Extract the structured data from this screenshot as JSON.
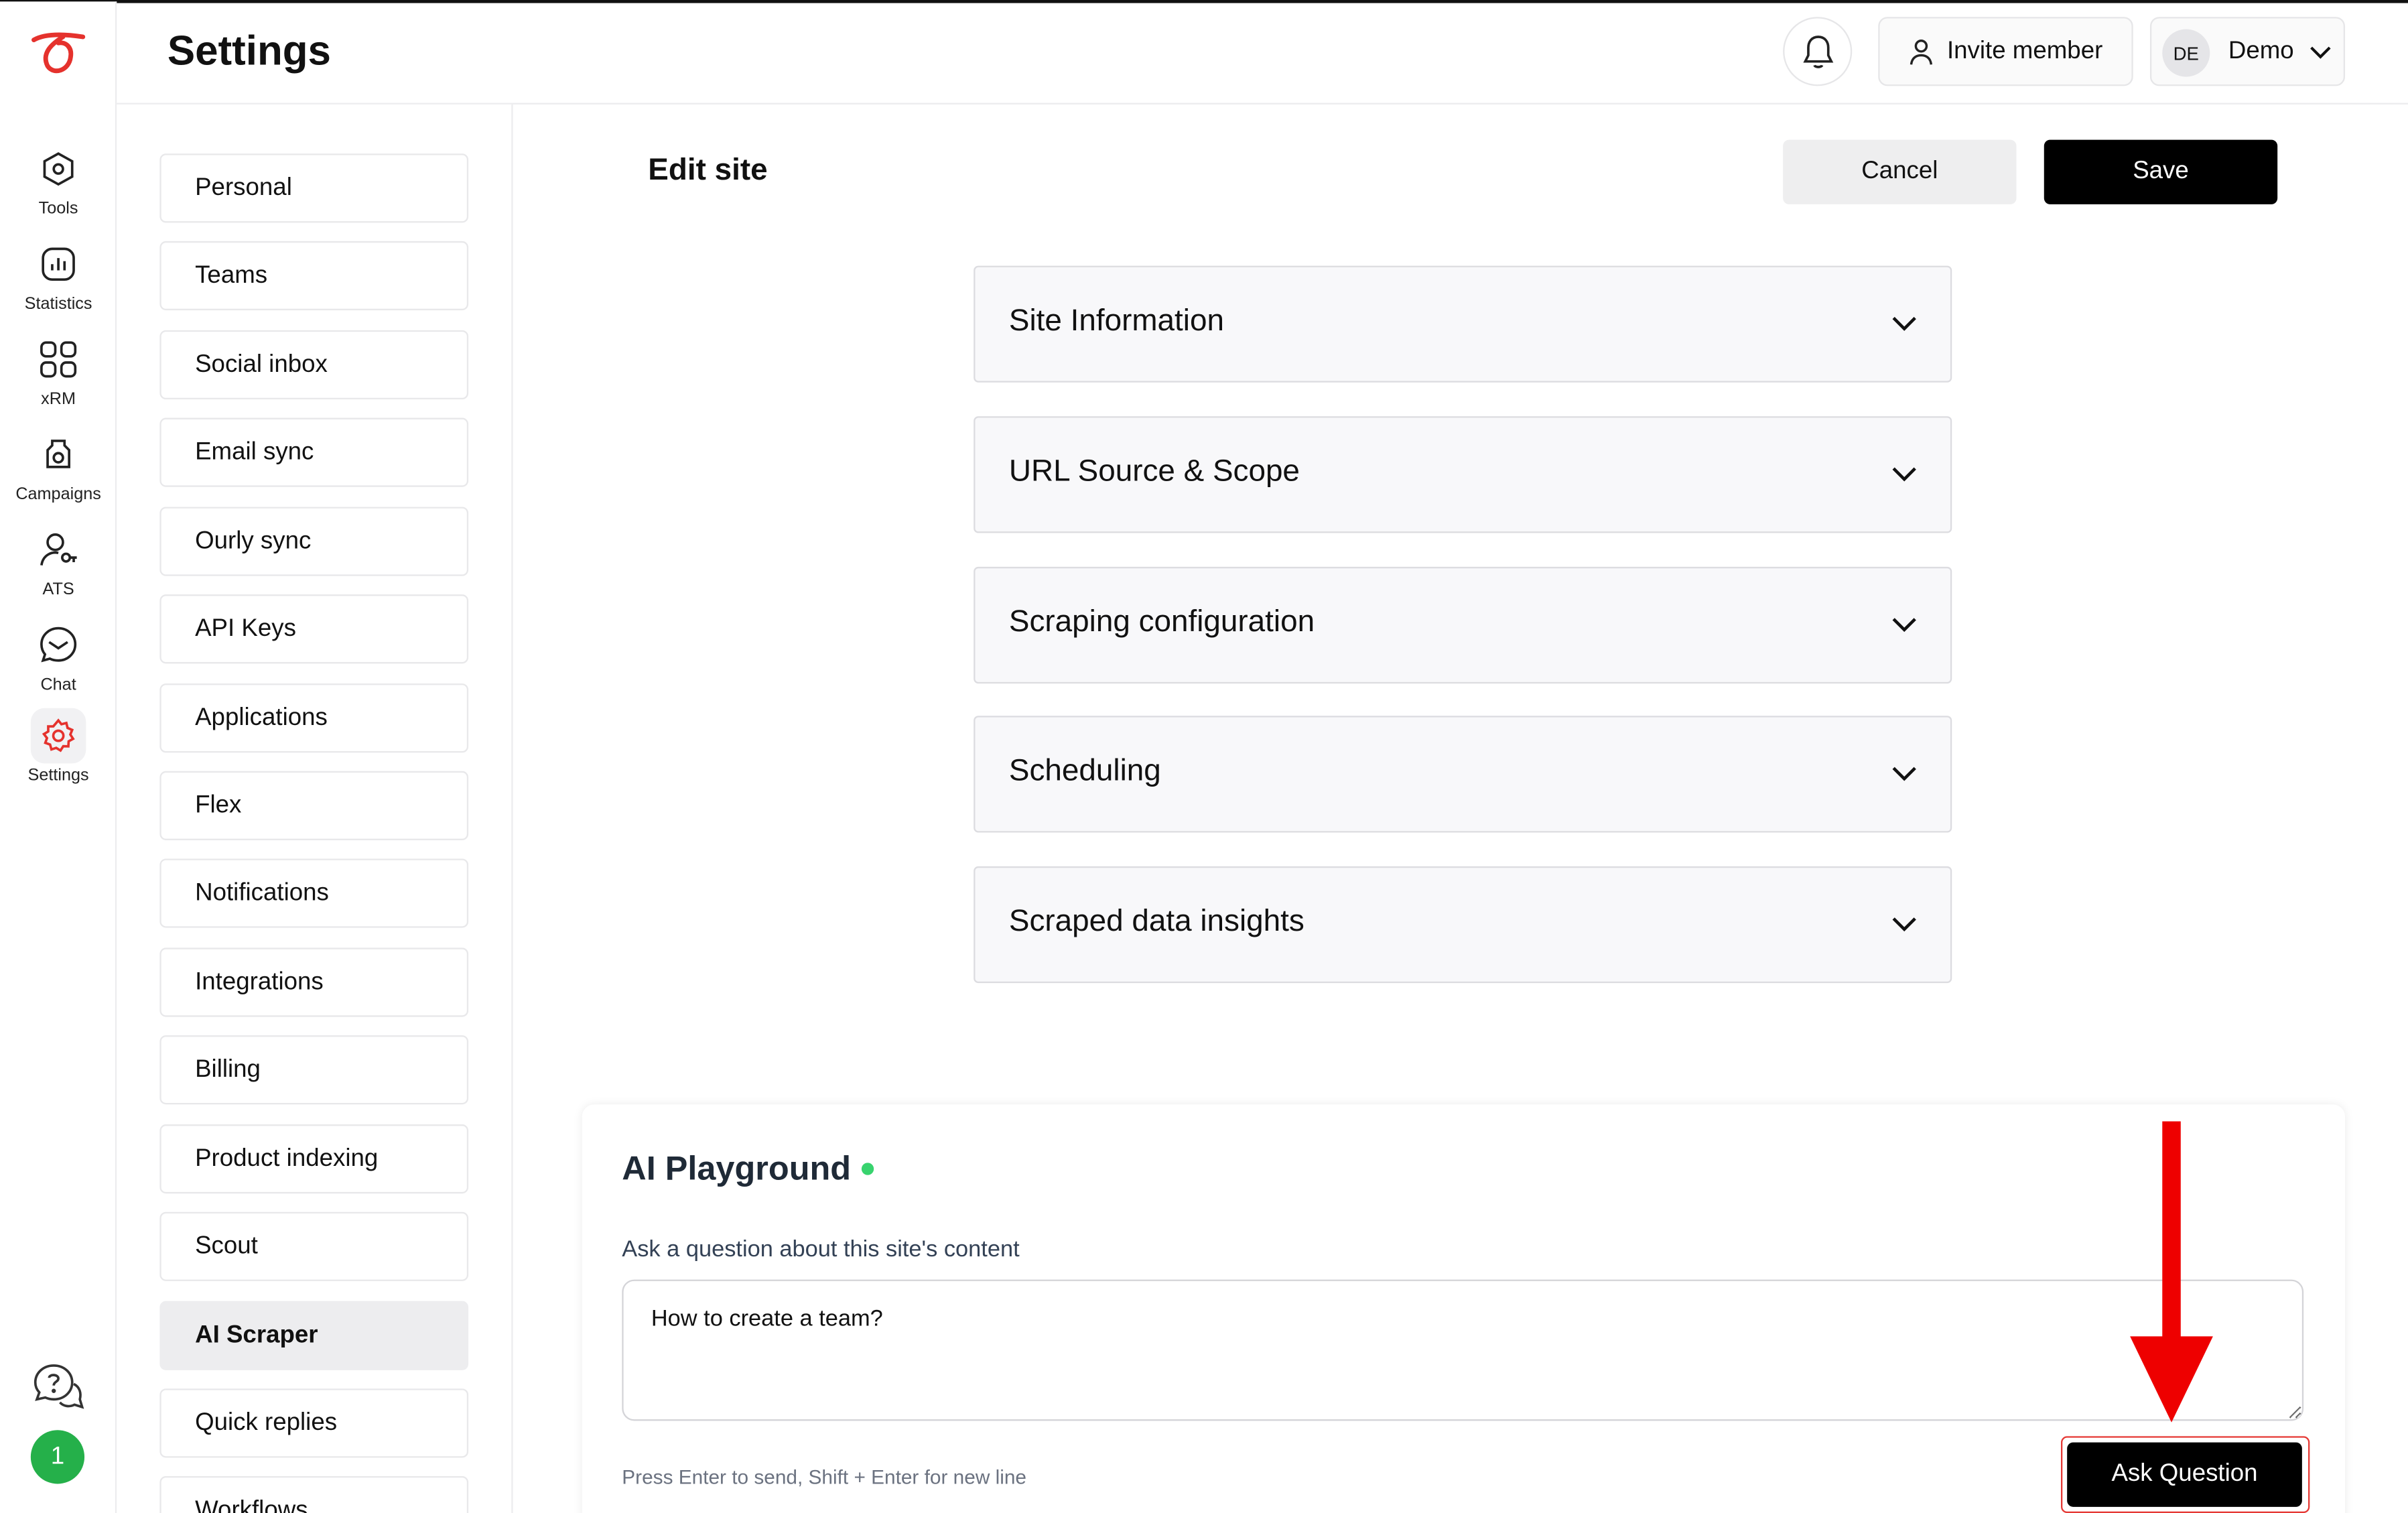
{
  "app": {
    "page_title": "Settings"
  },
  "header": {
    "invite_label": "Invite member",
    "user": {
      "initials": "DE",
      "name": "Demo"
    }
  },
  "rail": {
    "items": [
      {
        "label": "Tools",
        "icon": "hexagon-tools-icon"
      },
      {
        "label": "Statistics",
        "icon": "bar-chart-icon"
      },
      {
        "label": "xRM",
        "icon": "grid-icon"
      },
      {
        "label": "Campaigns",
        "icon": "megaphone-icon"
      },
      {
        "label": "ATS",
        "icon": "user-key-icon"
      },
      {
        "label": "Chat",
        "icon": "chat-bubble-icon"
      },
      {
        "label": "Settings",
        "icon": "gear-icon",
        "active": true
      }
    ],
    "notification_count": "1"
  },
  "settings_nav": {
    "items": [
      "Personal",
      "Teams",
      "Social inbox",
      "Email sync",
      "Ourly sync",
      "API Keys",
      "Applications",
      "Flex",
      "Notifications",
      "Integrations",
      "Billing",
      "Product indexing",
      "Scout",
      "AI Scraper",
      "Quick replies",
      "Workflows"
    ],
    "active": "AI Scraper"
  },
  "edit": {
    "title": "Edit site",
    "cancel_label": "Cancel",
    "save_label": "Save",
    "sections": [
      "Site Information",
      "URL Source & Scope",
      "Scraping configuration",
      "Scheduling",
      "Scraped data insights"
    ]
  },
  "playground": {
    "title": "AI Playground",
    "label": "Ask a question about this site's content",
    "input_value": "How to create a team?",
    "hint": "Press Enter to send, Shift + Enter for new line",
    "ask_label": "Ask Question",
    "status_color": "#38d36e"
  },
  "colors": {
    "accent_red": "#e53935",
    "primary": "#000000",
    "logo_red": "#e5322d"
  }
}
